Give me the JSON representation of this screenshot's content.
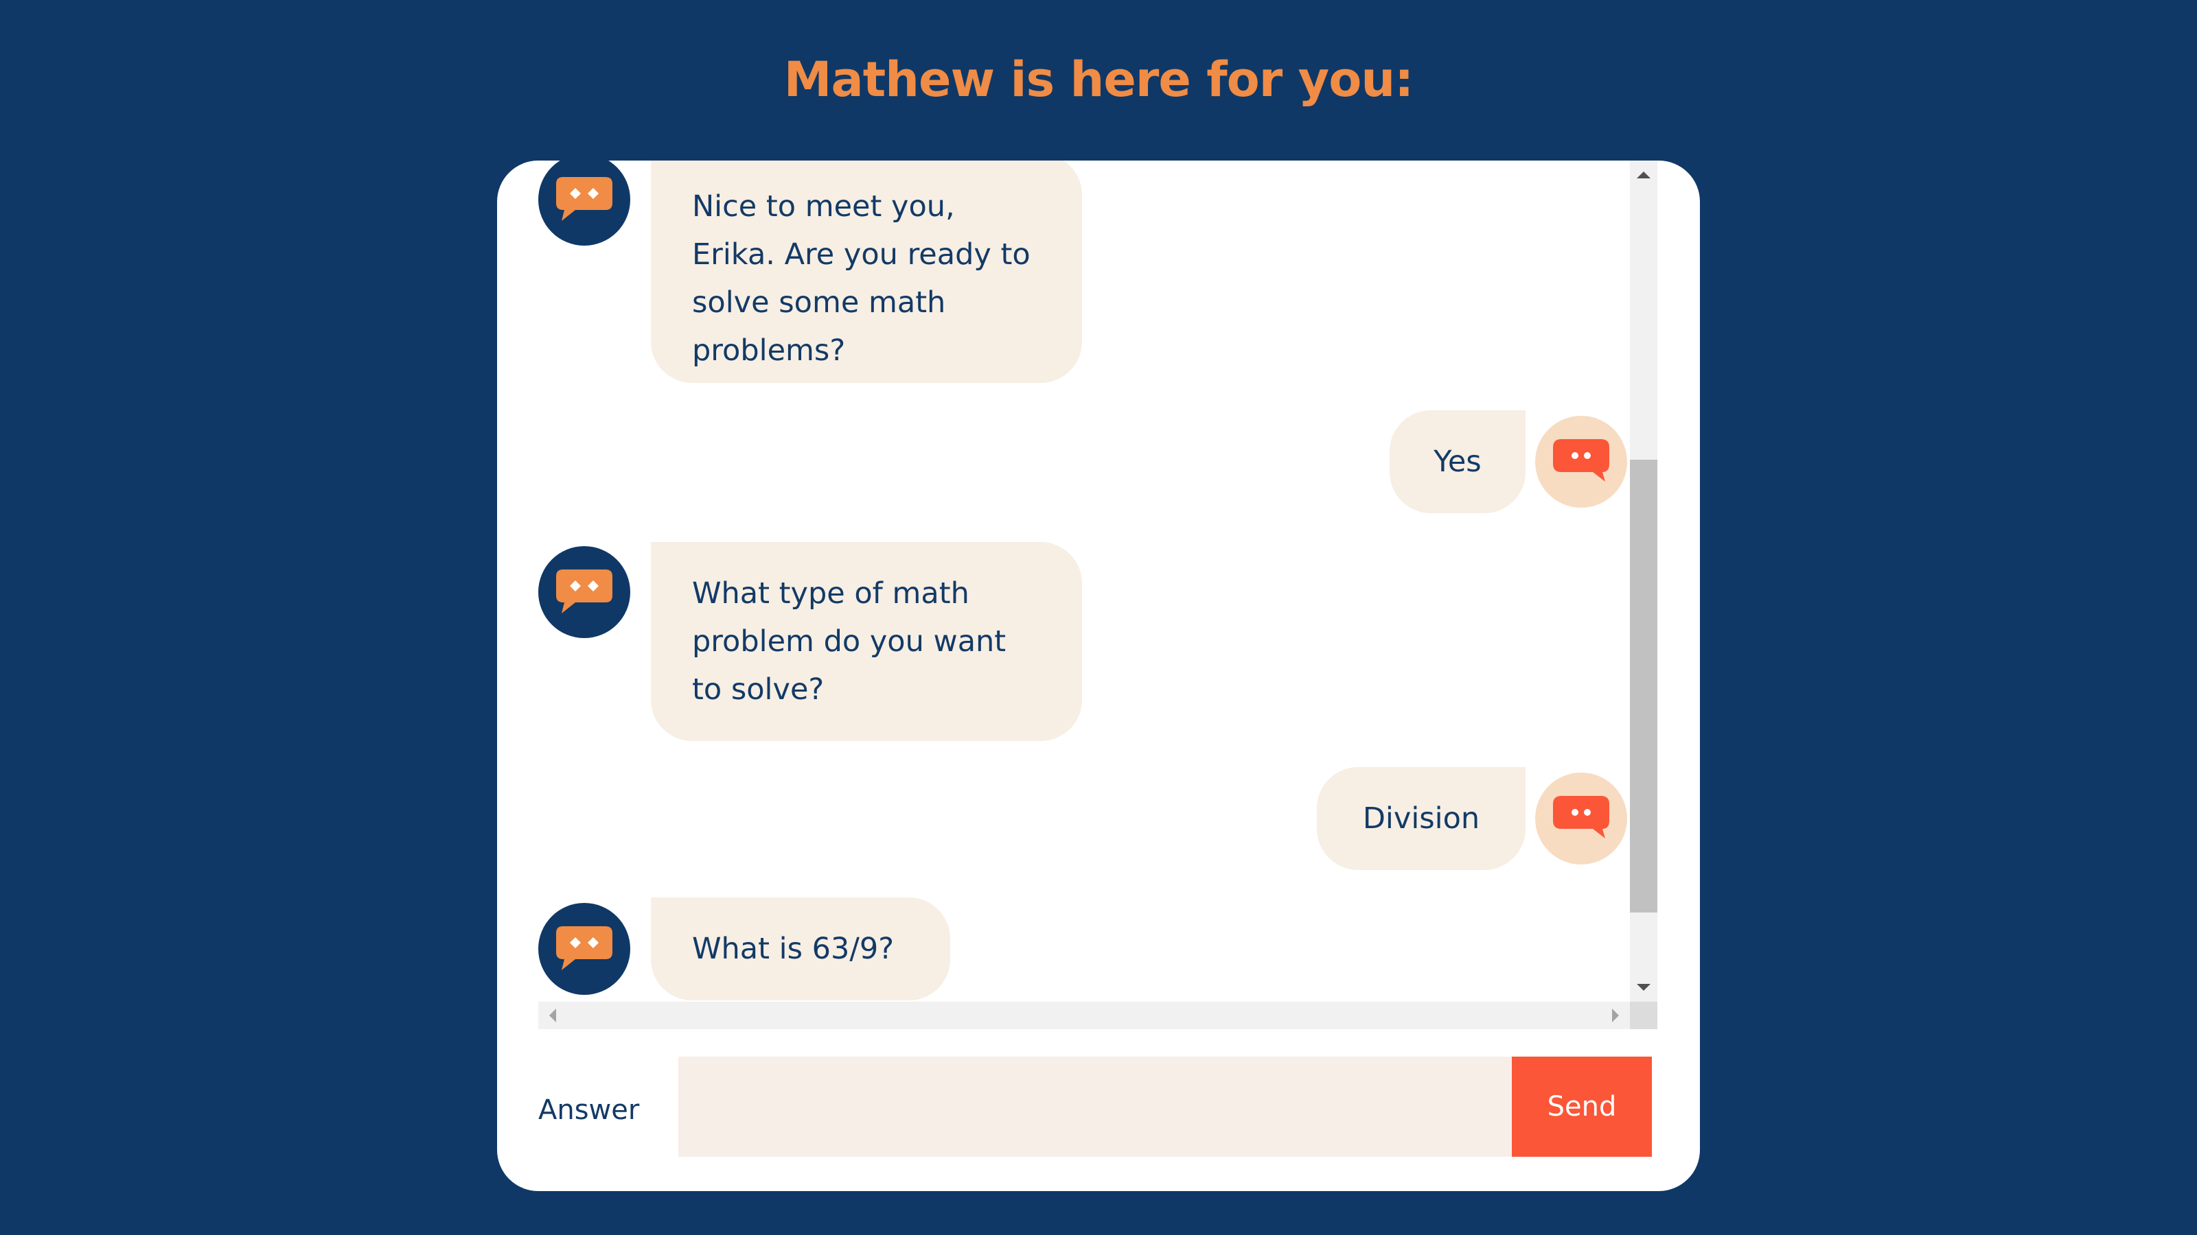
{
  "header": {
    "title": "Mathew is here for you:"
  },
  "colors": {
    "page_background": "#0f3866",
    "title": "#f08c45",
    "bubble_background": "#f7eee4",
    "text": "#123a66",
    "send_button": "#fb5638",
    "bot_icon": "#f08c45",
    "user_icon": "#fb5638"
  },
  "icons": {
    "bot_avatar": "chat-bubble-icon",
    "user_avatar": "chat-bubble-icon"
  },
  "messages": [
    {
      "sender": "bot",
      "text": "Nice to meet you, Erika. Are you ready to solve some math problems?"
    },
    {
      "sender": "user",
      "text": "Yes"
    },
    {
      "sender": "bot",
      "text": "What type of math problem do you want to solve?"
    },
    {
      "sender": "user",
      "text": "Division"
    },
    {
      "sender": "bot",
      "text": "What is 63/9?"
    }
  ],
  "composer": {
    "label": "Answer",
    "value": "",
    "send_label": "Send"
  }
}
